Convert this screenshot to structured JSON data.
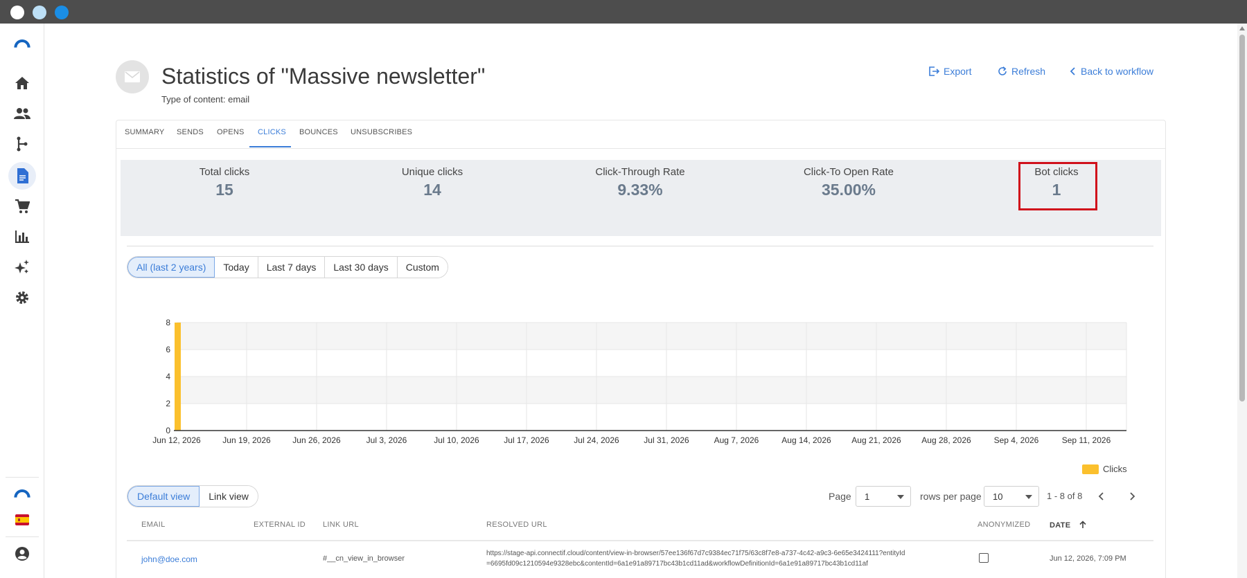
{
  "window": {
    "dots": [
      "#ffffff",
      "#bde0f7",
      "#1a8ee6"
    ]
  },
  "sidebar": {
    "items": [
      {
        "icon": "logo-icon"
      },
      {
        "icon": "home-icon"
      },
      {
        "icon": "people-icon"
      },
      {
        "icon": "workflow-icon"
      },
      {
        "icon": "document-icon",
        "active": true
      },
      {
        "icon": "cart-icon"
      },
      {
        "icon": "bar-chart-icon"
      },
      {
        "icon": "sparkle-icon"
      },
      {
        "icon": "gear-icon"
      },
      {
        "icon": "account-logo-icon"
      },
      {
        "icon": "spain-flag-icon"
      },
      {
        "icon": "user-icon"
      }
    ]
  },
  "header": {
    "title": "Statistics of \"Massive newsletter\"",
    "subtitle": "Type of content: email",
    "actions": {
      "export": "Export",
      "refresh": "Refresh",
      "back": "Back to workflow"
    }
  },
  "tabs": [
    "SUMMARY",
    "SENDS",
    "OPENS",
    "CLICKS",
    "BOUNCES",
    "UNSUBSCRIBES"
  ],
  "active_tab": "CLICKS",
  "stats": [
    {
      "label": "Total clicks",
      "value": "15"
    },
    {
      "label": "Unique clicks",
      "value": "14"
    },
    {
      "label": "Click-Through Rate",
      "value": "9.33%"
    },
    {
      "label": "Click-To Open Rate",
      "value": "35.00%"
    },
    {
      "label": "Bot clicks",
      "value": "1"
    }
  ],
  "ranges": [
    "All (last 2 years)",
    "Today",
    "Last 7 days",
    "Last 30 days",
    "Custom"
  ],
  "active_range": "All (last 2 years)",
  "chart_data": {
    "type": "bar",
    "categories": [
      "Jun 12, 2026",
      "Jun 19, 2026",
      "Jun 26, 2026",
      "Jul 3, 2026",
      "Jul 10, 2026",
      "Jul 17, 2026",
      "Jul 24, 2026",
      "Jul 31, 2026",
      "Aug 7, 2026",
      "Aug 14, 2026",
      "Aug 21, 2026",
      "Aug 28, 2026",
      "Sep 4, 2026",
      "Sep 11, 2026"
    ],
    "series": [
      {
        "name": "Clicks",
        "color": "#fbc02d",
        "values": [
          8,
          0,
          0,
          0,
          0,
          0,
          0,
          0,
          0,
          0,
          0,
          0,
          0,
          0
        ]
      }
    ],
    "yticks": [
      0,
      2,
      4,
      6,
      8
    ],
    "ylim": [
      0,
      8
    ],
    "grid": true,
    "legend": "bottom-right"
  },
  "views": [
    "Default view",
    "Link view"
  ],
  "active_view": "Default view",
  "pager": {
    "page_label": "Page",
    "page_value": "1",
    "rows_label": "rows per page",
    "rows_value": "10",
    "range_text": "1 - 8 of 8"
  },
  "table": {
    "columns": [
      "EMAIL",
      "EXTERNAL ID",
      "LINK URL",
      "RESOLVED URL",
      "ANONYMIZED",
      "DATE"
    ],
    "rows": [
      {
        "email": "john@doe.com",
        "external_id": "",
        "link_url": "#__cn_view_in_browser",
        "resolved_url_line1": "https://stage-api.connectif.cloud/content/view-in-browser/57ee136f67d7c9384ec71f75/63c8f7e8-a737-4c42-a9c3-6e65e3424111?entityId",
        "resolved_url_line2": "=6695fd09c1210594e9328ebc&contentId=6a1e91a89717bc43b1cd11ad&workflowDefinitionId=6a1e91a89717bc43b1cd11af",
        "anonymized": false,
        "date": "Jun 12, 2026, 7:09 PM"
      }
    ]
  }
}
